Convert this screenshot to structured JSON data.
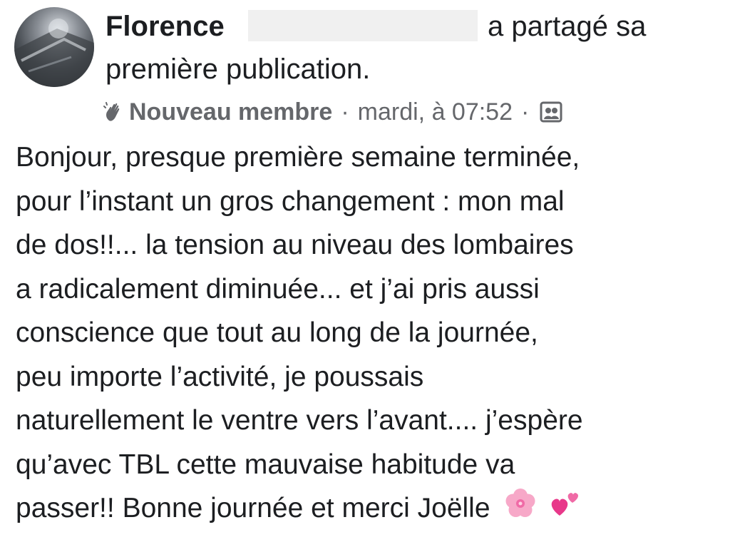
{
  "post": {
    "author_name": "Florence",
    "action_text_line1": "a partagé sa",
    "action_text_line2": "première publication.",
    "badge": "Nouveau membre",
    "separator": "·",
    "timestamp": "mardi, à 07:52",
    "audience_icon": "group-audience-icon",
    "badge_icon": "wave-hand-icon",
    "body_lines": [
      "Bonjour, presque première semaine terminée,",
      "pour l’instant un gros changement : mon mal",
      "de dos!!... la tension au niveau des lombaires",
      "a radicalement diminuée... et j’ai pris aussi",
      "conscience que tout au long de la journée,",
      "peu importe l’activité, je poussais",
      "naturellement le ventre vers l’avant.... j’espère",
      "qu’avec TBL cette mauvaise habitude va",
      "passer!! Bonne journée et merci Joëlle"
    ],
    "emojis": [
      "cherry-blossom-emoji",
      "two-hearts-emoji"
    ]
  },
  "colors": {
    "text": "#1c1e21",
    "meta_text": "#65676b",
    "redaction": "#f0f0f0",
    "emoji_pink": "#f06aa6"
  }
}
